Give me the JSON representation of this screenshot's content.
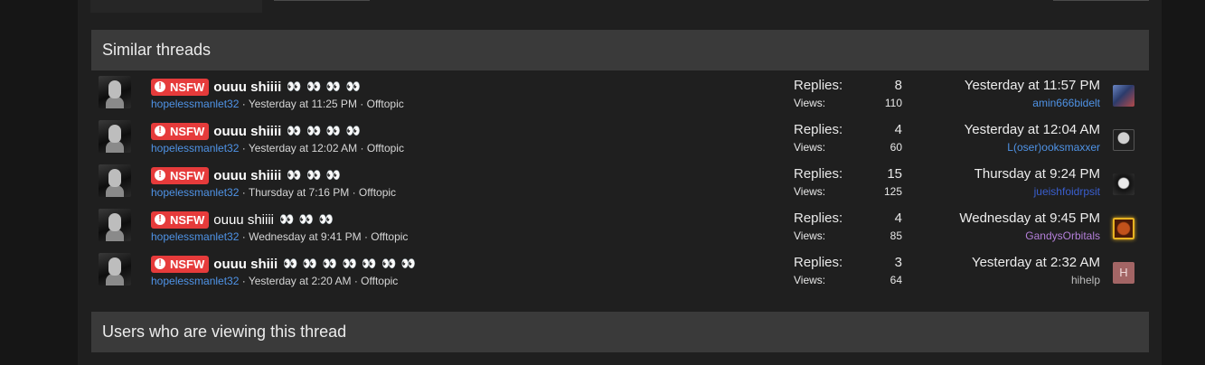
{
  "sections": {
    "similar_title": "Similar threads",
    "viewing_title": "Users who are viewing this thread"
  },
  "labels": {
    "replies": "Replies:",
    "views": "Views:"
  },
  "prefix": {
    "label": "NSFW",
    "color": "#e63b3b",
    "icon": "alert-circle-icon"
  },
  "threads": [
    {
      "title": "ouuu shiiii",
      "emoji": "👀 👀 👀 👀",
      "author": "hopelessmanlet32",
      "started": "Yesterday at 11:25 PM",
      "forum": "Offtopic",
      "replies": "8",
      "views": "110",
      "latest_date": "Yesterday at 11:57 PM",
      "latest_user": "amin666bidelt"
    },
    {
      "title": "ouuu shiiii",
      "emoji": "👀 👀 👀 👀",
      "author": "hopelessmanlet32",
      "started": "Yesterday at 12:02 AM",
      "forum": "Offtopic",
      "replies": "4",
      "views": "60",
      "latest_date": "Yesterday at 12:04 AM",
      "latest_user": "L(oser)ooksmaxxer"
    },
    {
      "title": "ouuu shiiii",
      "emoji": "👀 👀 👀",
      "author": "hopelessmanlet32",
      "started": "Thursday at 7:16 PM",
      "forum": "Offtopic",
      "replies": "15",
      "views": "125",
      "latest_date": "Thursday at 9:24 PM",
      "latest_user": "jueishfoidrpsit"
    },
    {
      "title": "ouuu shiiii",
      "emoji": "👀 👀 👀",
      "author": "hopelessmanlet32",
      "started": "Wednesday at 9:41 PM",
      "forum": "Offtopic",
      "replies": "4",
      "views": "85",
      "latest_date": "Wednesday at 9:45 PM",
      "latest_user": "GandysOrbitals"
    },
    {
      "title": "ouuu shiii",
      "emoji": "👀 👀 👀 👀 👀 👀 👀",
      "author": "hopelessmanlet32",
      "started": "Yesterday at 2:20 AM",
      "forum": "Offtopic",
      "replies": "3",
      "views": "64",
      "latest_date": "Yesterday at 2:32 AM",
      "latest_user": "hihelp",
      "latest_user_initial": "H"
    }
  ],
  "colors": {
    "username_blue": "#4f93e6",
    "username_darkblue": "#3a5fcf",
    "username_purple": "#b37fd8",
    "username_gray": "#bdbdbd",
    "avatar_highlight": "#e8b321"
  }
}
